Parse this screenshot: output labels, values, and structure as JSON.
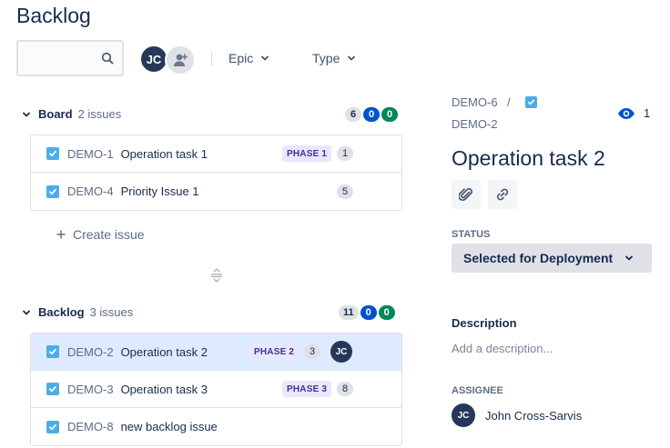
{
  "page": {
    "title": "Backlog"
  },
  "toolbar": {
    "search": {
      "value": "",
      "placeholder": ""
    },
    "avatar_initials": "JC",
    "filters": [
      {
        "label": "Epic"
      },
      {
        "label": "Type"
      }
    ]
  },
  "board": {
    "name": "Board",
    "count": "2 issues",
    "badges": {
      "todo": "6",
      "in_progress": "0",
      "done": "0"
    },
    "issues": [
      {
        "key": "DEMO-1",
        "summary": "Operation task 1",
        "epic": "PHASE 1",
        "estimate": "1"
      },
      {
        "key": "DEMO-4",
        "summary": "Priority Issue 1",
        "epic": "",
        "estimate": "5"
      }
    ],
    "create_label": "Create issue"
  },
  "backlog": {
    "name": "Backlog",
    "count": "3 issues",
    "badges": {
      "todo": "11",
      "in_progress": "0",
      "done": "0"
    },
    "issues": [
      {
        "key": "DEMO-2",
        "summary": "Operation task 2",
        "epic": "PHASE 2",
        "estimate": "3",
        "assignee": "JC",
        "selected": true
      },
      {
        "key": "DEMO-3",
        "summary": "Operation task 3",
        "epic": "PHASE 3",
        "estimate": "8"
      },
      {
        "key": "DEMO-8",
        "summary": "new backlog issue",
        "epic": "",
        "estimate": ""
      }
    ]
  },
  "detail": {
    "parent_key": "DEMO-6",
    "separator": "/",
    "issue_key": "DEMO-2",
    "watchers": "1",
    "title": "Operation task 2",
    "status_label": "STATUS",
    "status_value": "Selected for Deployment",
    "description_label": "Description",
    "description_placeholder": "Add a description...",
    "assignee_label": "ASSIGNEE",
    "assignee_initials": "JC",
    "assignee_name": "John Cross-Sarvis"
  },
  "colors": {
    "text": "#172b4d",
    "checkbox": "#4bade8",
    "badge_blue": "#0052cc",
    "badge_green": "#00875a",
    "epic_bg": "#eae6ff",
    "epic_text": "#403294",
    "selected_row": "#deebff"
  },
  "icons": [
    "search-icon",
    "add-person-icon",
    "chevron-down-icon",
    "checkbox-checked-icon",
    "plus-icon",
    "drag-handle-icon",
    "eye-icon",
    "attachment-icon",
    "link-icon"
  ]
}
